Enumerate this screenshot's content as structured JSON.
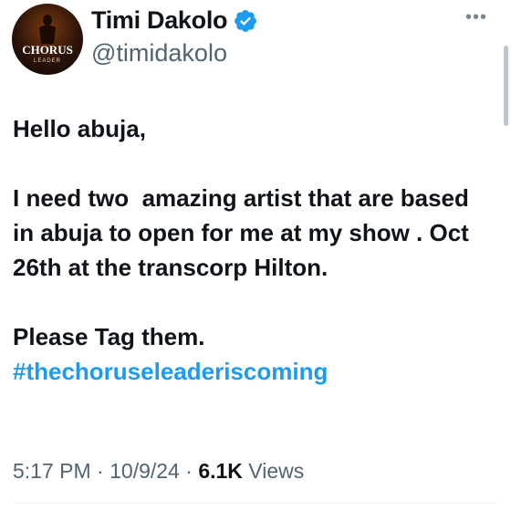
{
  "author": {
    "name": "Timi Dakolo",
    "handle": "@timidakolo",
    "verified": true,
    "avatar": {
      "line1": "CHORUS",
      "line2": "LEADER",
      "accent_letter": "C"
    }
  },
  "menu": {
    "more_icon": "more-horizontal-icon"
  },
  "tweet": {
    "paragraphs": [
      "Hello abuja,",
      "I need two  amazing artist that are based in abuja to open for me at my show . Oct 26th at the transcorp Hilton.",
      "Please Tag them."
    ],
    "hashtag": "#thechoruseleaderiscoming"
  },
  "meta": {
    "time": "5:17 PM",
    "separator": "·",
    "date": "10/9/24",
    "views_count": "6.1K",
    "views_label": "Views"
  },
  "colors": {
    "link": "#1d9bf0",
    "verified": "#1d9bf0",
    "secondary_text": "#536471"
  }
}
